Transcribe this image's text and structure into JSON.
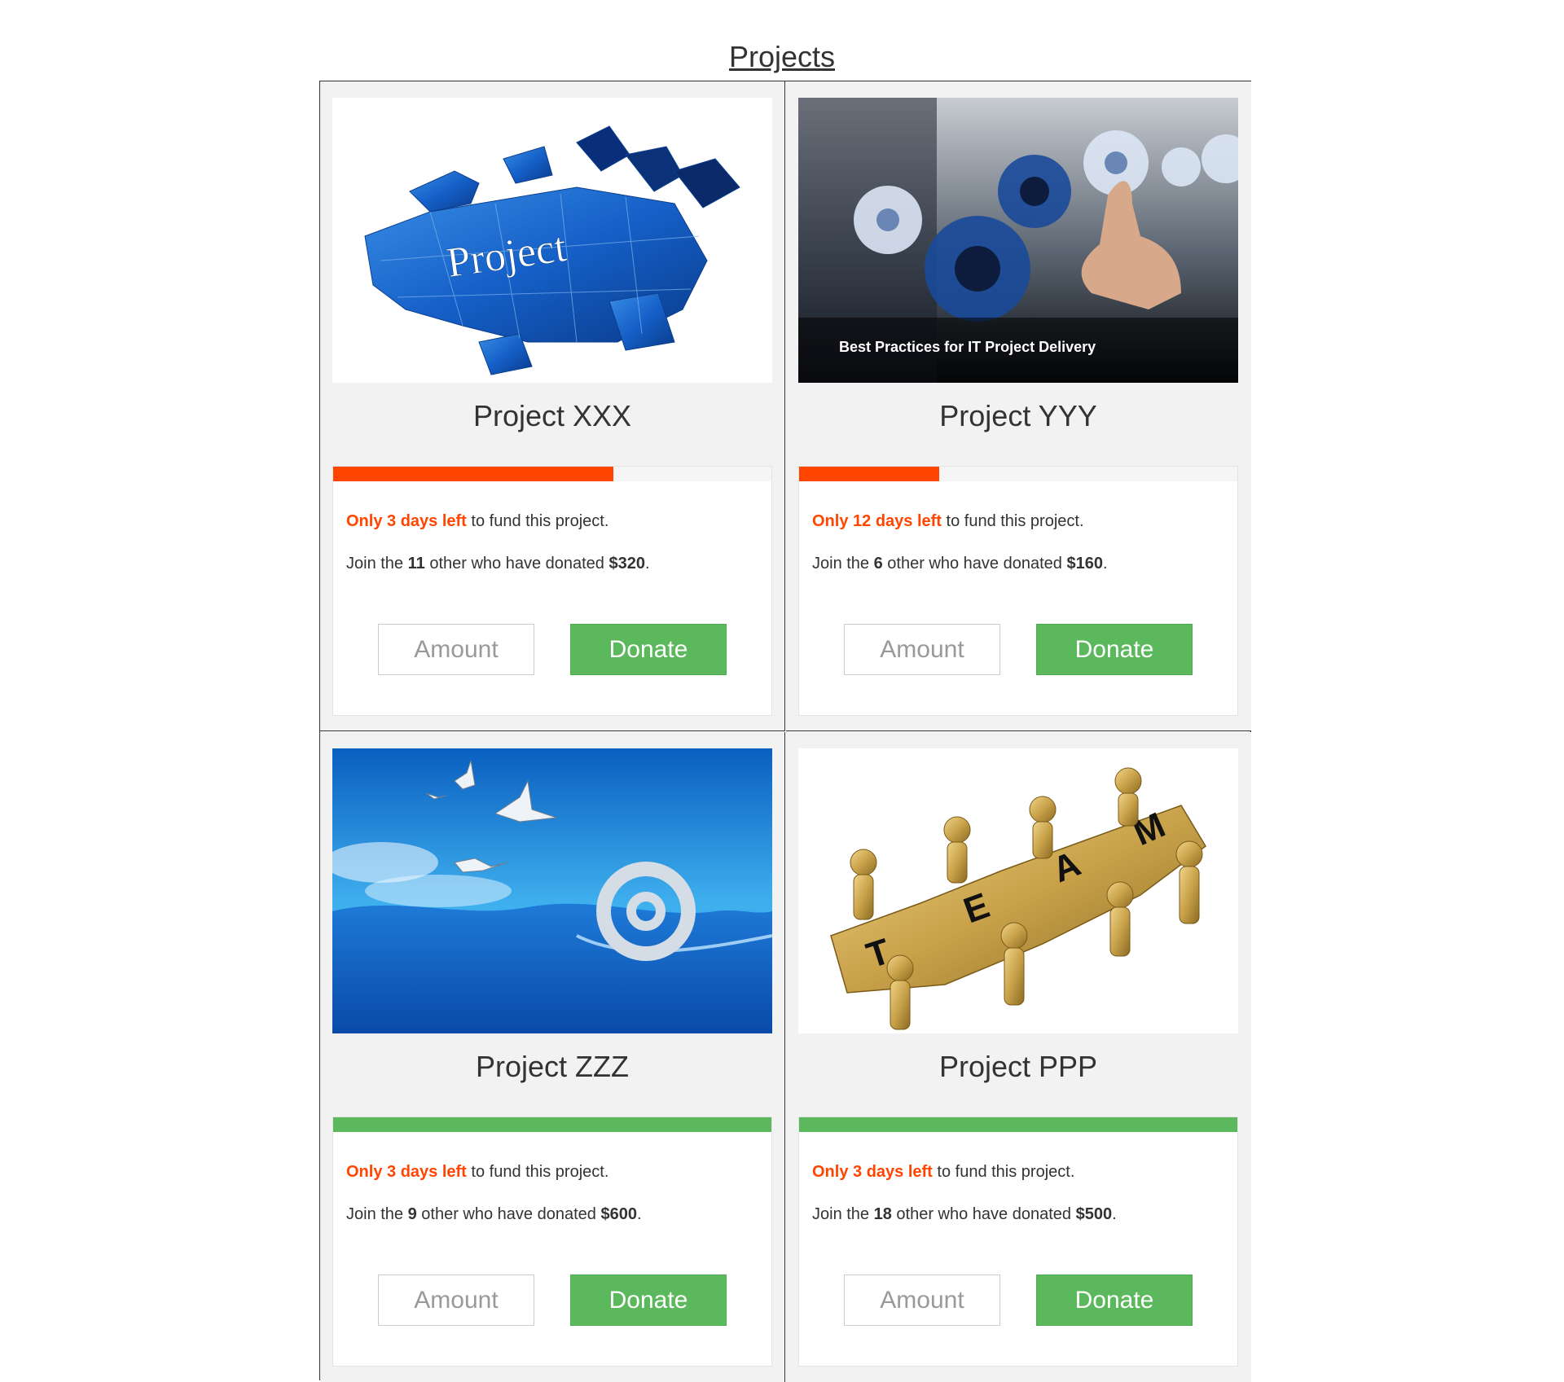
{
  "page": {
    "title": "Projects"
  },
  "colors": {
    "accent": "#ff4500",
    "success": "#5cb85c"
  },
  "projects": [
    {
      "name": "Project XXX",
      "image_icon": "puzzle-project-image",
      "image_text": "Project",
      "progress_fraction": 0.64,
      "progress_complete": false,
      "days_highlight": "Only 3 days left",
      "days_suffix": " to fund this project.",
      "donors_prefix": "Join the ",
      "donor_count": "11",
      "donors_middle": " other who have donated ",
      "donated_amount": "$320",
      "donors_suffix": ".",
      "amount_placeholder": "Amount",
      "donate_label": "Donate"
    },
    {
      "name": "Project YYY",
      "image_icon": "gears-hand-image",
      "image_text": "Best Practices for IT Project Delivery",
      "progress_fraction": 0.32,
      "progress_complete": false,
      "days_highlight": "Only 12 days left",
      "days_suffix": " to fund this project.",
      "donors_prefix": "Join the ",
      "donor_count": "6",
      "donors_middle": " other who have donated ",
      "donated_amount": "$160",
      "donors_suffix": ".",
      "amount_placeholder": "Amount",
      "donate_label": "Donate"
    },
    {
      "name": "Project ZZZ",
      "image_icon": "ocean-email-image",
      "image_text": "@",
      "progress_fraction": 1.0,
      "progress_complete": true,
      "days_highlight": "Only 3 days left",
      "days_suffix": " to fund this project.",
      "donors_prefix": "Join the ",
      "donor_count": "9",
      "donors_middle": " other who have donated ",
      "donated_amount": "$600",
      "donors_suffix": ".",
      "amount_placeholder": "Amount",
      "donate_label": "Donate"
    },
    {
      "name": "Project PPP",
      "image_icon": "team-puzzle-image",
      "image_text": "TEAM",
      "progress_fraction": 1.0,
      "progress_complete": true,
      "days_highlight": "Only 3 days left",
      "days_suffix": " to fund this project.",
      "donors_prefix": "Join the ",
      "donor_count": "18",
      "donors_middle": " other who have donated ",
      "donated_amount": "$500",
      "donors_suffix": ".",
      "amount_placeholder": "Amount",
      "donate_label": "Donate"
    }
  ]
}
